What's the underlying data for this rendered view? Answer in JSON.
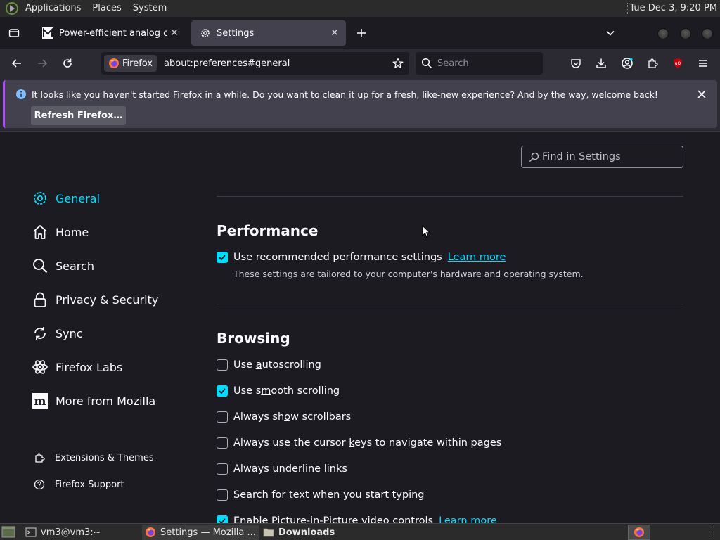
{
  "panel": {
    "menus": [
      "Applications",
      "Places",
      "System"
    ],
    "clock": "Tue Dec  3,  9:20 PM"
  },
  "tabs": [
    {
      "title": "Power-efficient analog com",
      "icon": "mathworks-icon"
    },
    {
      "title": "Settings",
      "icon": "gear-icon",
      "active": true
    }
  ],
  "urlbar": {
    "identity_label": "Firefox",
    "url": "about:preferences#general"
  },
  "searchbar": {
    "placeholder": "Search"
  },
  "notification": {
    "message": "It looks like you haven't started Firefox in a while. Do you want to clean it up for a fresh, like-new experience? And by the way, welcome back!",
    "button_label": "Refresh Firefox…",
    "accent_color": "#b24bff"
  },
  "find": {
    "placeholder": "Find in Settings"
  },
  "categories": [
    {
      "label": "General",
      "icon": "gear-icon",
      "selected": true
    },
    {
      "label": "Home",
      "icon": "home-icon"
    },
    {
      "label": "Search",
      "icon": "search-icon"
    },
    {
      "label": "Privacy & Security",
      "icon": "lock-icon"
    },
    {
      "label": "Sync",
      "icon": "sync-icon"
    },
    {
      "label": "Firefox Labs",
      "icon": "atom-icon"
    },
    {
      "label": "More from Mozilla",
      "icon": "mozilla-icon"
    }
  ],
  "footer_links": [
    {
      "label": "Extensions & Themes",
      "icon": "puzzle-icon"
    },
    {
      "label": "Firefox Support",
      "icon": "help-icon"
    }
  ],
  "performance": {
    "title": "Performance",
    "option_label": "Use recommended performance settings",
    "option_checked": true,
    "learn_more": "Learn more",
    "description": "These settings are tailored to your computer's hardware and operating system."
  },
  "browsing": {
    "title": "Browsing",
    "options": [
      {
        "pre": "Use ",
        "key": "a",
        "post": "utoscrolling",
        "checked": false
      },
      {
        "pre": "Use s",
        "key": "m",
        "post": "ooth scrolling",
        "checked": true
      },
      {
        "pre": "Always sh",
        "key": "o",
        "post": "w scrollbars",
        "checked": false
      },
      {
        "pre": "Always use the cursor ",
        "key": "k",
        "post": "eys to navigate within pages",
        "checked": false
      },
      {
        "pre": "Always ",
        "key": "u",
        "post": "nderline links",
        "checked": false
      },
      {
        "pre": "Search for te",
        "key": "x",
        "post": "t when you start typing",
        "checked": false
      },
      {
        "pre": "Enable Picture-in-Picture video controls",
        "key": "",
        "post": "",
        "checked": true,
        "learn_more": "Learn more"
      }
    ]
  },
  "taskbar": {
    "items": [
      {
        "label": "vm3@vm3:~",
        "icon": "terminal-icon"
      },
      {
        "label": "Settings — Mozilla ...",
        "icon": "firefox-icon",
        "active": true
      },
      {
        "label": "Downloads",
        "icon": "folder-icon"
      }
    ]
  },
  "colors": {
    "accent": "#00ddff",
    "background": "#1c1b22",
    "toolbar": "#2b2a33"
  }
}
